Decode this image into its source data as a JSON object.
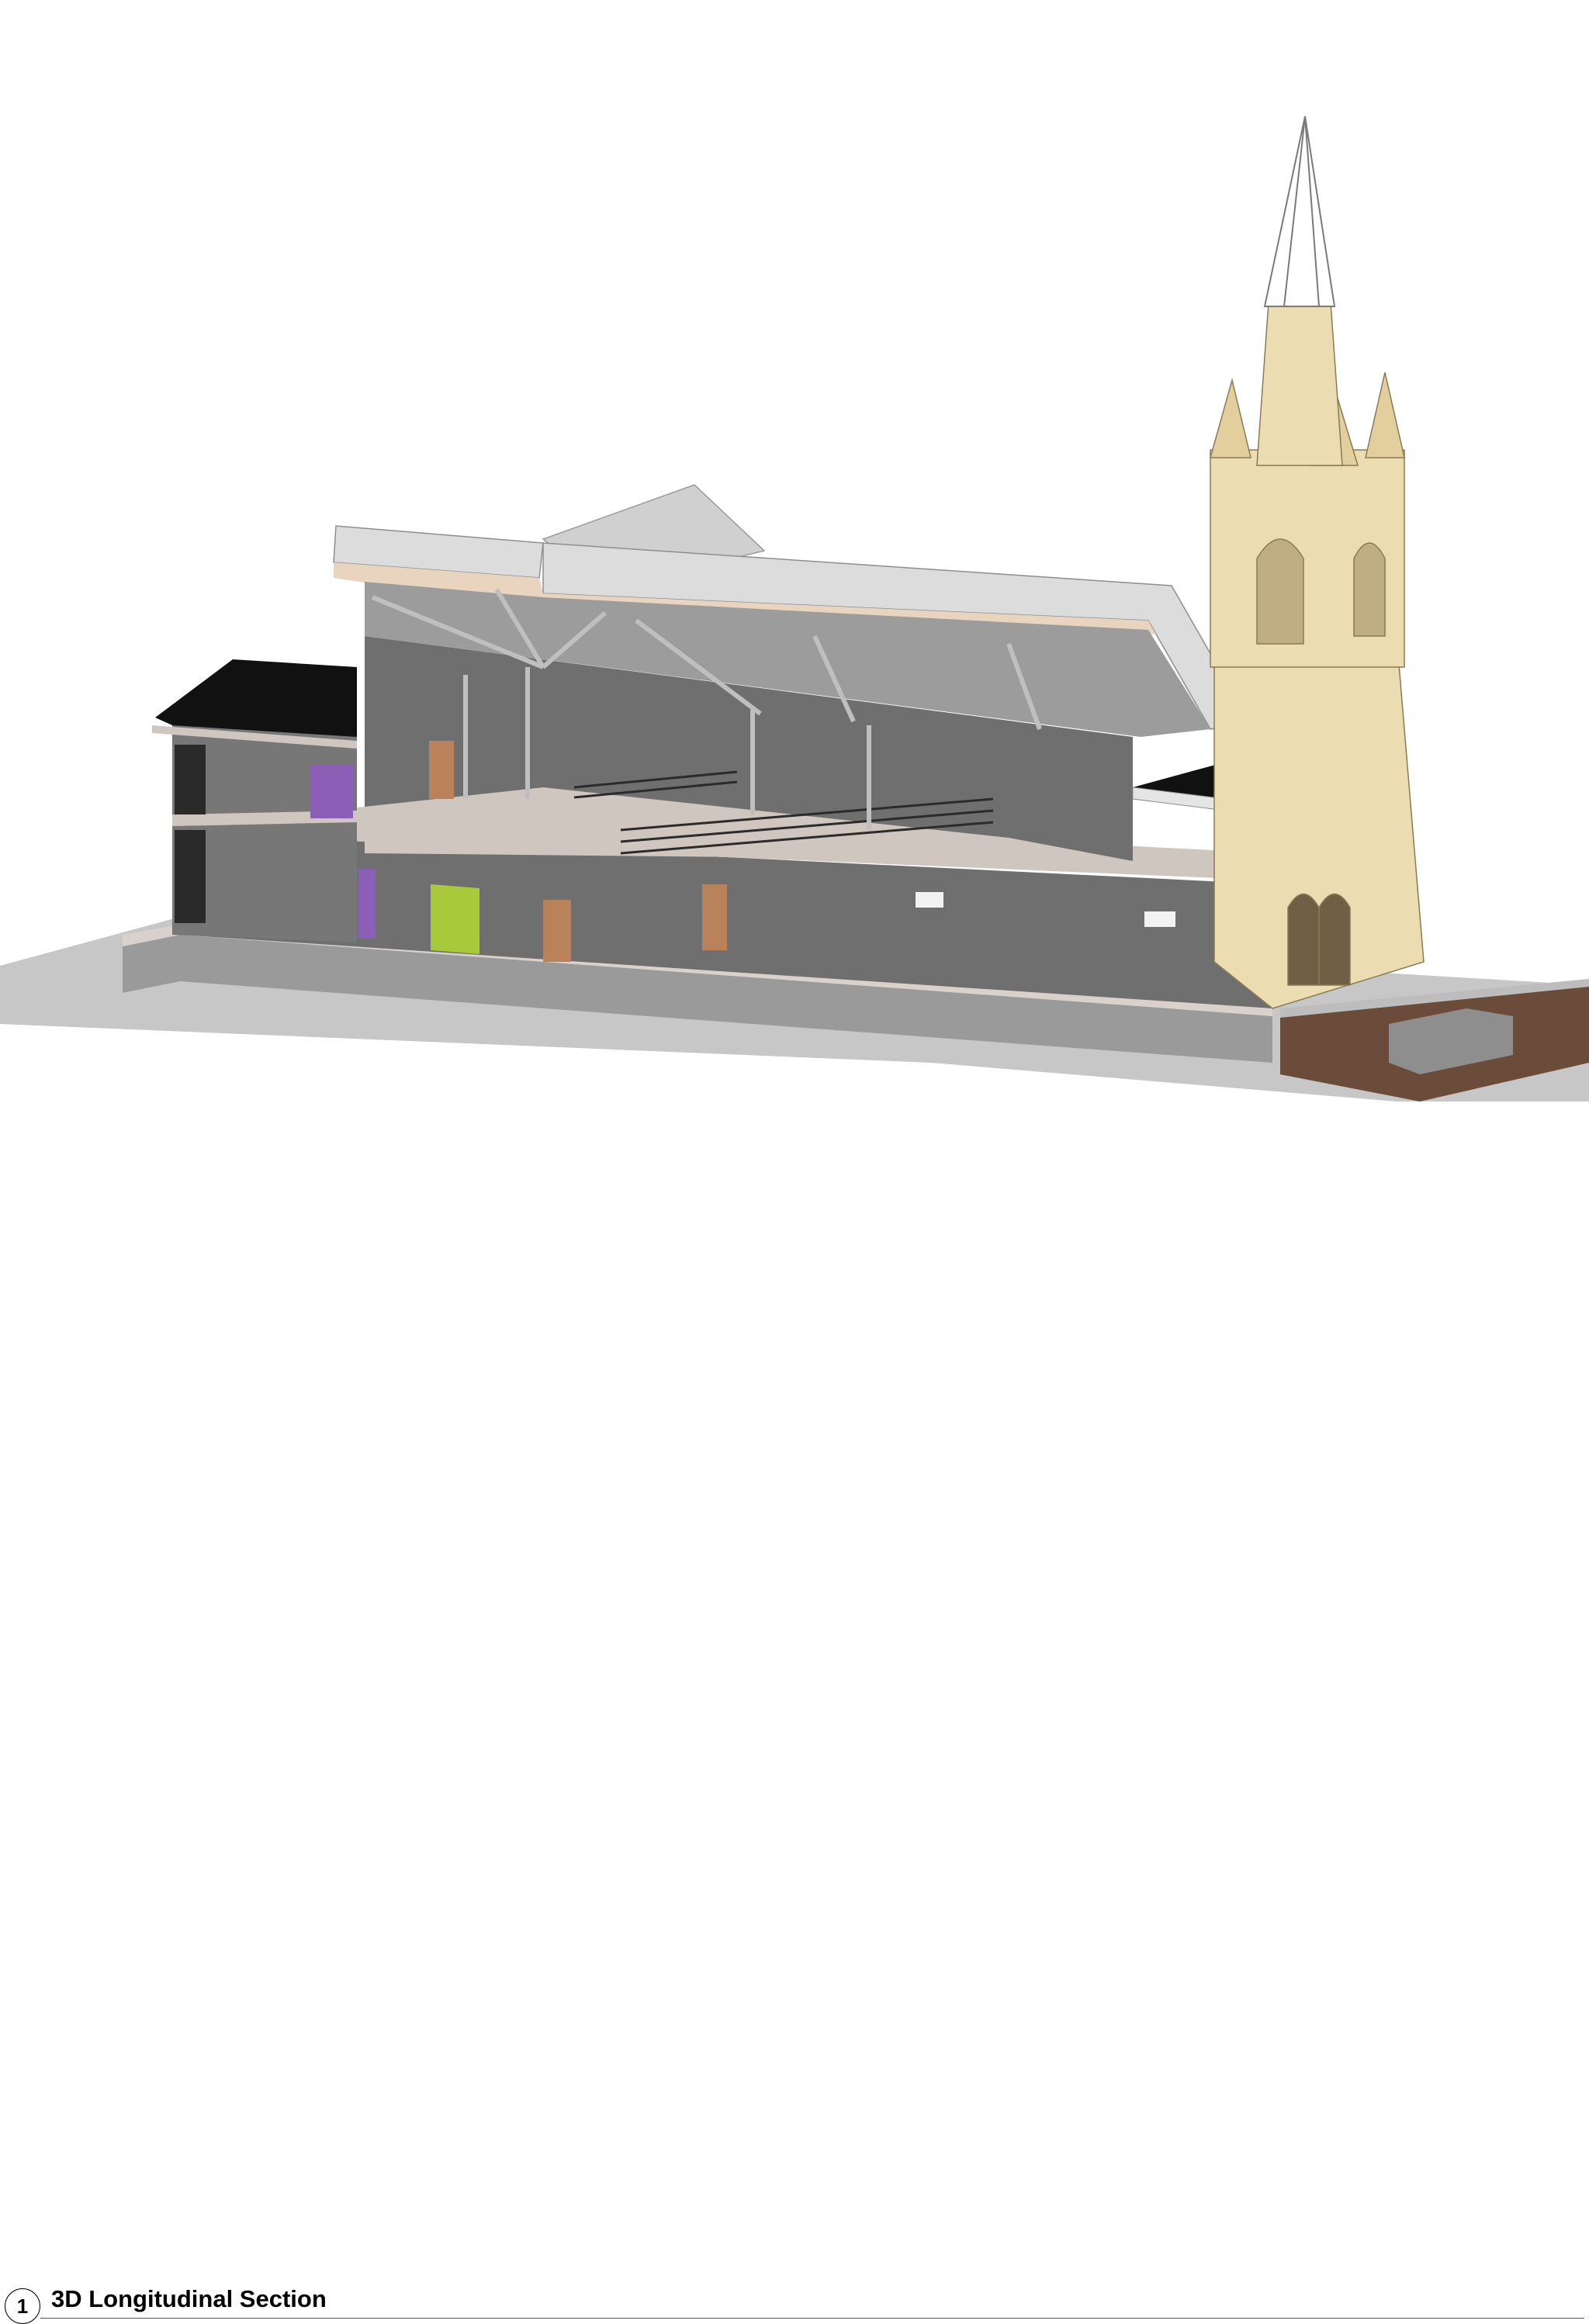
{
  "view": {
    "number": "1",
    "title": "3D Longitudinal Section"
  },
  "colors": {
    "background": "#ffffff",
    "shadow": "#c7c7c7",
    "roof_metal": "#dcdcdc",
    "interior_wall": "#6f6f6f",
    "floor_slab": "#cfc6bf",
    "stone_tower": "#ecdcb2",
    "flat_roof": "#111111",
    "green_panel": "#a7c93a",
    "purple_accent": "#8a5fb5",
    "door_wood": "#b9825a",
    "brick_base": "#6b4b3a"
  }
}
